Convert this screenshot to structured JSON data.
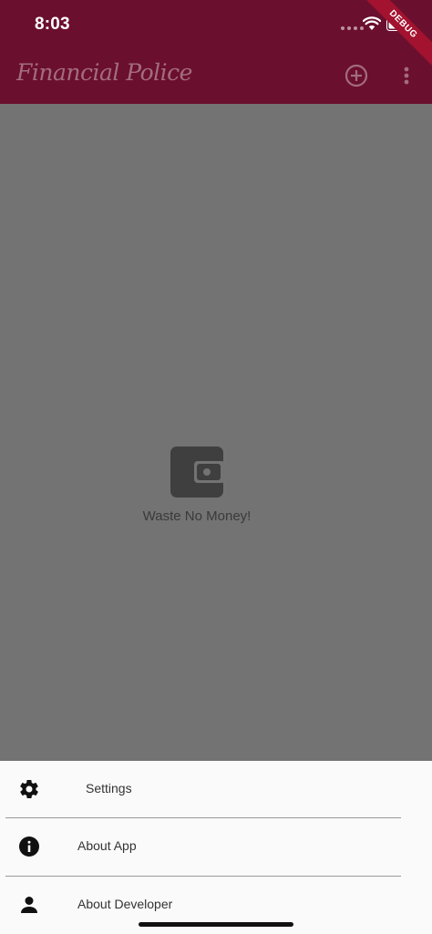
{
  "status_bar": {
    "time": "8:03",
    "icons": [
      "signal-dots-icon",
      "wifi-icon",
      "battery-icon"
    ]
  },
  "debug_banner": "DEBUG",
  "app_bar": {
    "title": "Financial Police",
    "actions": [
      "add-circle-icon",
      "more-vert-icon"
    ]
  },
  "empty_state": {
    "icon": "wallet-icon",
    "message": "Waste No Money!"
  },
  "menu": {
    "items": [
      {
        "label": "Settings",
        "icon": "gear-icon"
      },
      {
        "label": "About App",
        "icon": "info-icon"
      },
      {
        "label": "About Developer",
        "icon": "person-icon"
      }
    ]
  },
  "colors": {
    "app_bar": "#6b0f2f",
    "scrim": "#737373",
    "sheet": "#fafafa",
    "debug_ribbon": "#a3122f"
  }
}
